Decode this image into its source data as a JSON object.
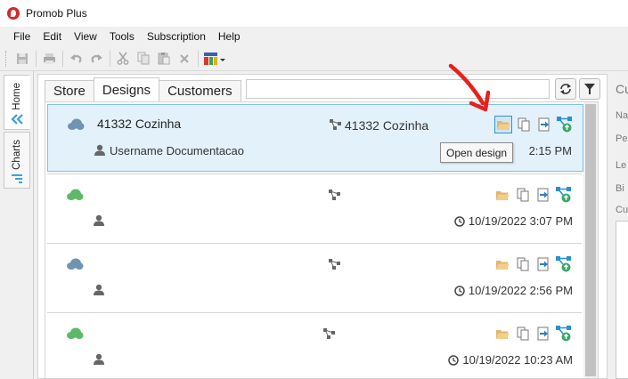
{
  "app": {
    "title": "Promob Plus"
  },
  "menu": [
    "File",
    "Edit",
    "View",
    "Tools",
    "Subscription",
    "Help"
  ],
  "side_tabs": {
    "home": "Home",
    "charts": "Charts"
  },
  "tabs": {
    "store": "Store",
    "designs": "Designs",
    "customers": "Customers"
  },
  "search": {
    "value": ""
  },
  "tooltip": "Open design",
  "designs": [
    {
      "name": "41332 Cozinha",
      "project": "41332 Cozinha",
      "user": "Username Documentacao",
      "date": "2:15 PM",
      "cloud_color": "#6f93b0",
      "selected": true
    },
    {
      "name": "",
      "project": "",
      "user": "",
      "date": "10/19/2022 3:07 PM",
      "cloud_color": "#5cb86a",
      "selected": false
    },
    {
      "name": "",
      "project": "",
      "user": "",
      "date": "10/19/2022 2:56 PM",
      "cloud_color": "#6f93b0",
      "selected": false
    },
    {
      "name": "",
      "project": "",
      "user": "",
      "date": "10/19/2022 10:23 AM",
      "cloud_color": "#5cb86a",
      "selected": false
    }
  ],
  "right_panel": {
    "labels": [
      "Cu",
      "Na",
      "Pe",
      "Le",
      "Bi",
      "Cu"
    ]
  },
  "colors": {
    "selection_bg": "#e3f1fa",
    "selection_border": "#7fc0e8",
    "annotation_arrow": "#e8201a",
    "app_logo": "#d02a2a"
  }
}
